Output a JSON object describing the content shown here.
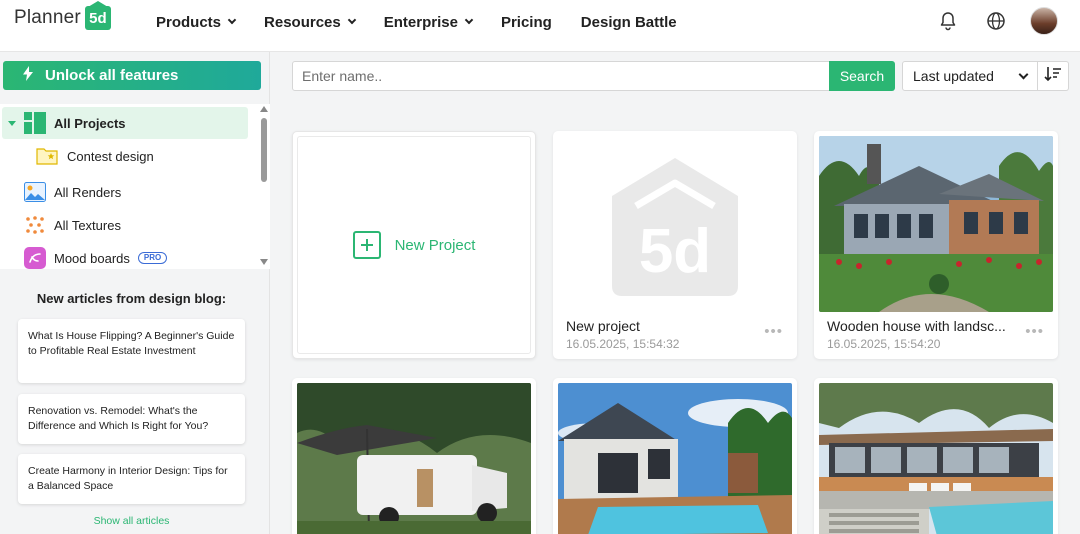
{
  "header": {
    "logo_text": "Planner",
    "logo_badge": "5d",
    "nav": [
      {
        "label": "Products",
        "has_menu": true
      },
      {
        "label": "Resources",
        "has_menu": true
      },
      {
        "label": "Enterprise",
        "has_menu": true
      },
      {
        "label": "Pricing",
        "has_menu": false
      },
      {
        "label": "Design Battle",
        "has_menu": false
      }
    ],
    "icons": [
      "bell-icon",
      "globe-icon",
      "avatar"
    ]
  },
  "sidebar": {
    "unlock_label": "Unlock all features",
    "tree": [
      {
        "label": "All Projects",
        "icon": "projects-icon",
        "active": true
      },
      {
        "label": "Contest design",
        "icon": "folder-star-icon",
        "active": false
      },
      {
        "label": "All Renders",
        "icon": "renders-icon",
        "active": false
      },
      {
        "label": "All Textures",
        "icon": "textures-icon",
        "active": false
      },
      {
        "label": "Mood boards",
        "icon": "mood-board-icon",
        "active": false,
        "badge": "PRO"
      }
    ],
    "blog": {
      "title": "New articles from design blog:",
      "articles": [
        "What Is House Flipping? A Beginner's Guide to Profitable Real Estate Investment",
        "Renovation vs. Remodel: What's the Difference and Which Is Right for You?",
        "Create Harmony in Interior Design: Tips for a Balanced Space"
      ],
      "show_all": "Show all articles"
    }
  },
  "toolbar": {
    "search_placeholder": "Enter name..",
    "search_button": "Search",
    "sort_value": "Last updated",
    "sort_direction_icon": "sort-descending-icon"
  },
  "projects": {
    "new_project_label": "New Project",
    "items": [
      {
        "title": "New project",
        "date": "16.05.2025, 15:54:32"
      },
      {
        "title": "Wooden house with landsc...",
        "date": "16.05.2025, 15:54:20"
      }
    ]
  },
  "colors": {
    "brand_green": "#2bb673",
    "accent_teal": "#1fa99a"
  }
}
